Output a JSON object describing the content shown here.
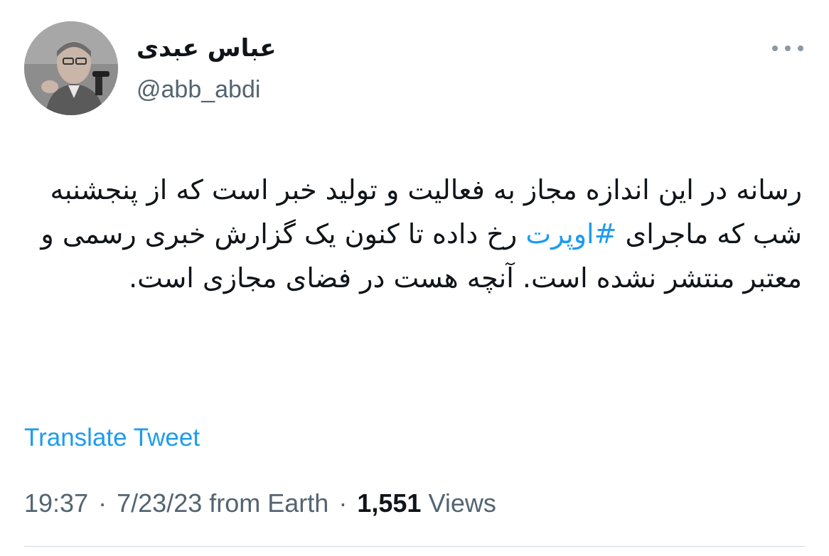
{
  "author": {
    "display_name": "عباس عبدی",
    "handle": "@abb_abdi",
    "avatar_icon": "profile-photo"
  },
  "menu": {
    "more_icon": "more-horizontal-icon"
  },
  "tweet": {
    "text_before_hashtag": "رسانه در این اندازه مجاز به فعالیت و تولید خبر است که از پنجشنبه شب که ماجرای ",
    "hashtag": "#اوپرت",
    "text_after_hashtag": " رخ داده تا کنون یک گزارش خبری رسمی و معتبر منتشر نشده است. آنچه هست در فضای مجازی است."
  },
  "translate_label": "Translate Tweet",
  "meta": {
    "time": "19:37",
    "separator": "·",
    "date": "7/23/23",
    "source": "from Earth",
    "views_count": "1,551",
    "views_label": "Views"
  },
  "colors": {
    "link": "#1d9bf0",
    "secondary_text": "#536471",
    "primary_text": "#0f1419",
    "divider": "#cfd9de"
  }
}
